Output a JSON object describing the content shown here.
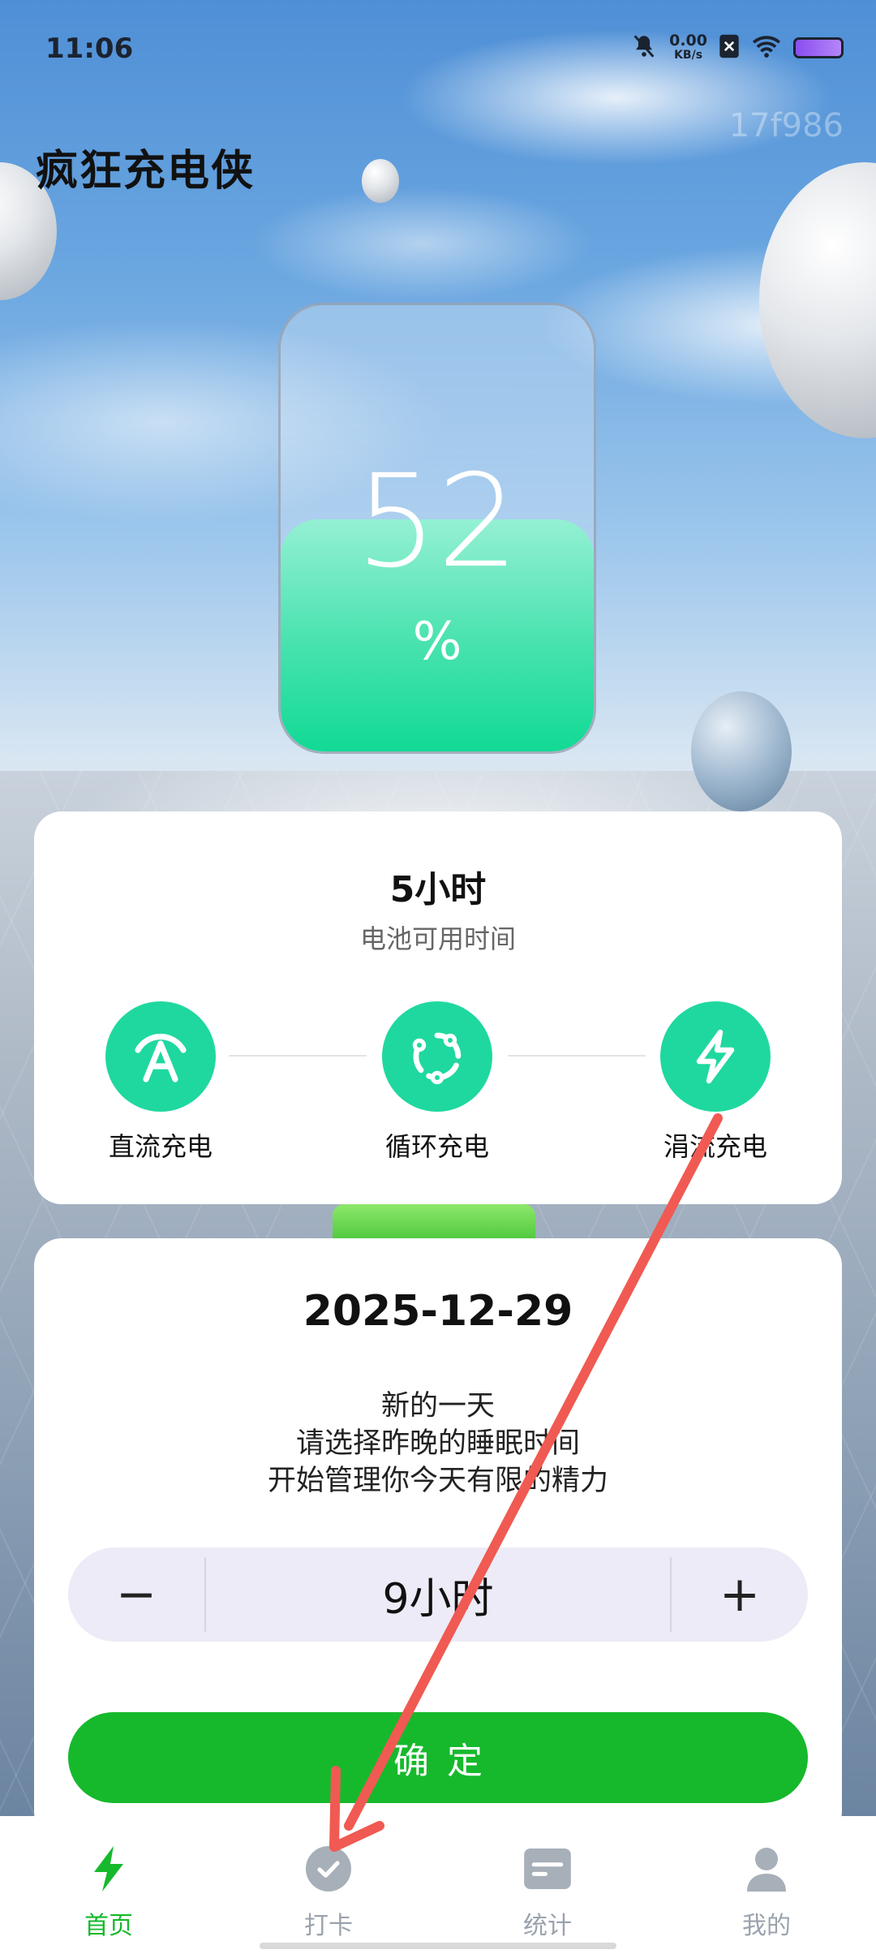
{
  "status_bar": {
    "time": "11:06",
    "net_speed_value": "0.00",
    "net_speed_unit": "KB/s",
    "icons": [
      "mute-bell-icon",
      "sim-off-icon",
      "wifi-icon",
      "battery-icon"
    ]
  },
  "header": {
    "app_title": "疯狂充电侠",
    "watermark": "17f986"
  },
  "battery": {
    "level": 52,
    "level_text": "52",
    "unit": "%"
  },
  "battery_card": {
    "hours": "5小时",
    "subtitle": "电池可用时间",
    "modes": [
      {
        "label": "直流充电",
        "icon": "a-arc-icon"
      },
      {
        "label": "循环充电",
        "icon": "cycle-icon"
      },
      {
        "label": "涓流充电",
        "icon": "lightning-icon"
      }
    ]
  },
  "sleep_card": {
    "date": "2025-12-29",
    "message_lines": [
      "新的一天",
      "请选择昨晚的睡眠时间",
      "开始管理你今天有限的精力"
    ],
    "minus_label": "−",
    "plus_label": "+",
    "value": "9小时",
    "confirm_label": "确定"
  },
  "nav": {
    "tabs": [
      {
        "label": "首页",
        "icon": "lightning-icon",
        "active": true
      },
      {
        "label": "打卡",
        "icon": "check-circle-icon",
        "active": false
      },
      {
        "label": "统计",
        "icon": "card-icon",
        "active": false
      },
      {
        "label": "我的",
        "icon": "person-icon",
        "active": false
      }
    ]
  },
  "colors": {
    "accent_green": "#16b92c",
    "mode_green": "#1fd89f",
    "arrow_red": "#f05a52"
  }
}
